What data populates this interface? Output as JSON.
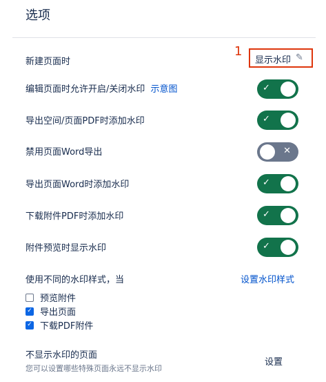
{
  "page": {
    "title": "选项"
  },
  "annotation": {
    "marker": "1"
  },
  "watermark_button": {
    "label": "显示水印",
    "icon": "pencil-icon"
  },
  "options": [
    {
      "label": "新建页面时"
    },
    {
      "label": "编辑页面时允许开启/关闭水印",
      "link": "示意图",
      "toggle": true
    },
    {
      "label": "导出空间/页面PDF时添加水印",
      "toggle": true
    },
    {
      "label": "禁用页面Word导出",
      "toggle": false
    },
    {
      "label": "导出页面Word时添加水印",
      "toggle": true
    },
    {
      "label": "下载附件PDF时添加水印",
      "toggle": true
    },
    {
      "label": "附件预览时显示水印",
      "toggle": true
    }
  ],
  "toggle_icons": {
    "on": "✓",
    "off": "✕"
  },
  "style_section": {
    "label": "使用不同的水印样式，当",
    "link": "设置水印样式",
    "checkboxes": [
      {
        "label": "预览附件",
        "checked": false
      },
      {
        "label": "导出页面",
        "checked": true
      },
      {
        "label": "下载PDF附件",
        "checked": true
      }
    ]
  },
  "exclusion": {
    "label": "不显示水印的页面",
    "description": "您可以设置哪些特殊页面永远不显示水印",
    "button": "设置"
  },
  "colors": {
    "toggle_on": "#12734b",
    "toggle_off": "#6b778c",
    "link": "#0052cc",
    "highlight": "#de350b"
  }
}
